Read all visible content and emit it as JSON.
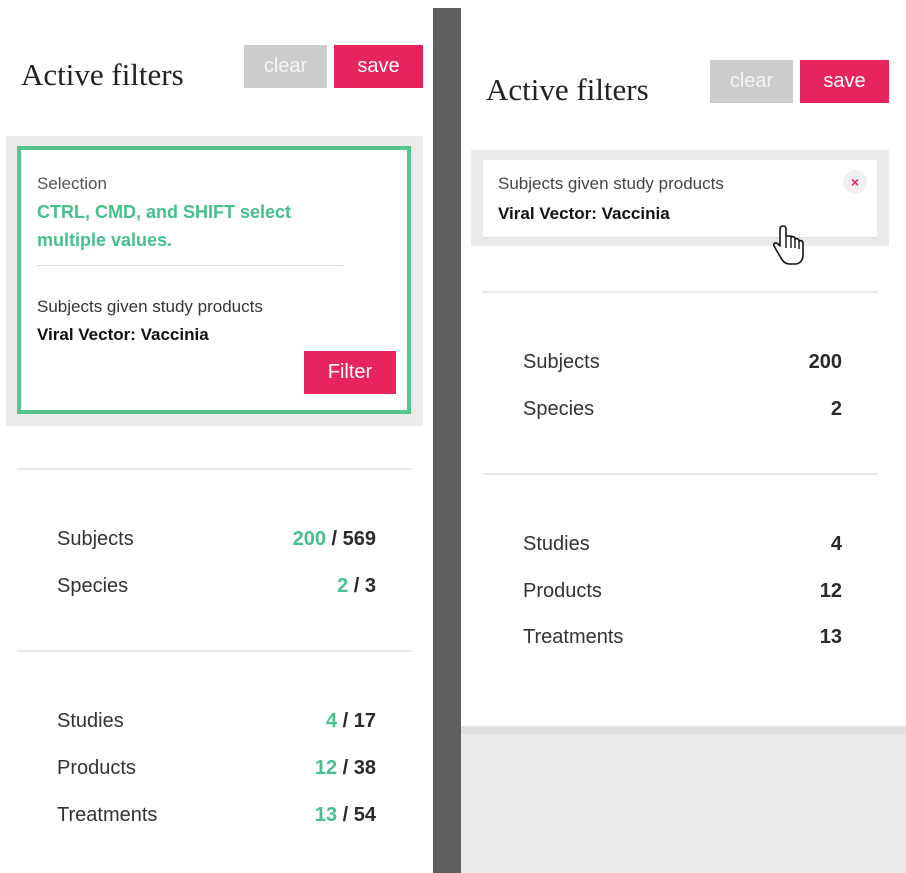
{
  "left": {
    "title": "Active filters",
    "clear_label": "clear",
    "save_label": "save",
    "selection": {
      "heading": "Selection",
      "hint": "CTRL, CMD, and SHIFT select multiple values.",
      "filter_name": "Subjects given study products",
      "filter_value": "Viral Vector: Vaccinia",
      "filter_button": "Filter"
    },
    "stats_group1": [
      {
        "label": "Subjects",
        "selected": "200",
        "total": "/ 569"
      },
      {
        "label": "Species",
        "selected": "2",
        "total": "/ 3"
      }
    ],
    "stats_group2": [
      {
        "label": "Studies",
        "selected": "4",
        "total": "/ 17"
      },
      {
        "label": "Products",
        "selected": "12",
        "total": "/ 38"
      },
      {
        "label": "Treatments",
        "selected": "13",
        "total": "/ 54"
      }
    ]
  },
  "right": {
    "title": "Active filters",
    "clear_label": "clear",
    "save_label": "save",
    "filter_card": {
      "name": "Subjects given study products",
      "value": "Viral Vector: Vaccinia",
      "remove_glyph": "×"
    },
    "stats_group1": [
      {
        "label": "Subjects",
        "value": "200"
      },
      {
        "label": "Species",
        "value": "2"
      }
    ],
    "stats_group2": [
      {
        "label": "Studies",
        "value": "4"
      },
      {
        "label": "Products",
        "value": "12"
      },
      {
        "label": "Treatments",
        "value": "13"
      }
    ]
  },
  "colors": {
    "accent_green": "#46c08a",
    "accent_pink": "#e8245c",
    "divider": "#5f5f5f"
  },
  "icons": {
    "remove": "close-icon",
    "cursor": "hand-pointer-icon"
  }
}
